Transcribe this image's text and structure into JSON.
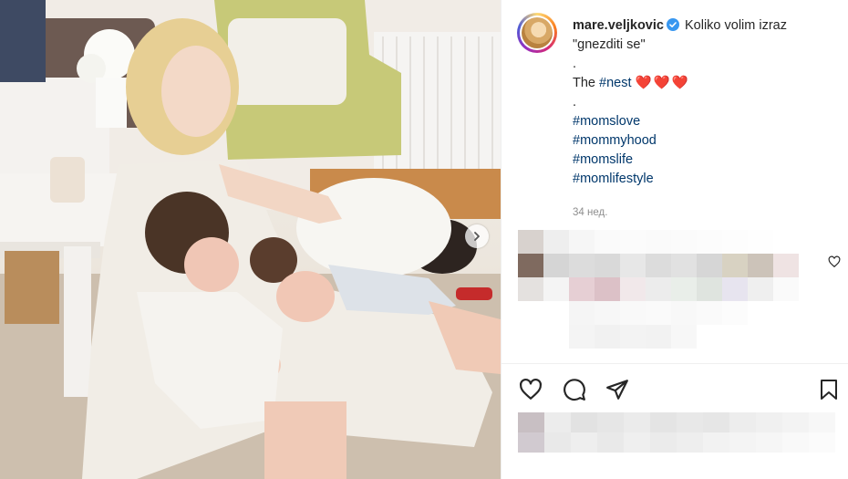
{
  "post": {
    "username": "mare.veljkovic",
    "caption_line1": "Koliko volim izraz",
    "caption_line2": "\"gnezditi se\"",
    "dot1": ".",
    "the_text": "The",
    "nest_tag": "#nest",
    "hearts": "❤️❤️❤️",
    "dot2": ".",
    "hashtags": [
      "#momslove",
      "#mommyhood",
      "#momslife",
      "#momlifestyle"
    ],
    "timestamp": "34 нед."
  },
  "icons": {
    "verified": "verified-badge-icon",
    "next": "chevron-right-icon",
    "like": "heart-icon",
    "comment": "comment-bubble-icon",
    "share": "paper-plane-icon",
    "save": "bookmark-icon",
    "comment_like": "small-heart-icon"
  },
  "colors": {
    "verified": "#3897f0",
    "hashtag": "#00376b",
    "timestamp": "#8e8e8e",
    "heart_emoji": "#e0243a"
  }
}
